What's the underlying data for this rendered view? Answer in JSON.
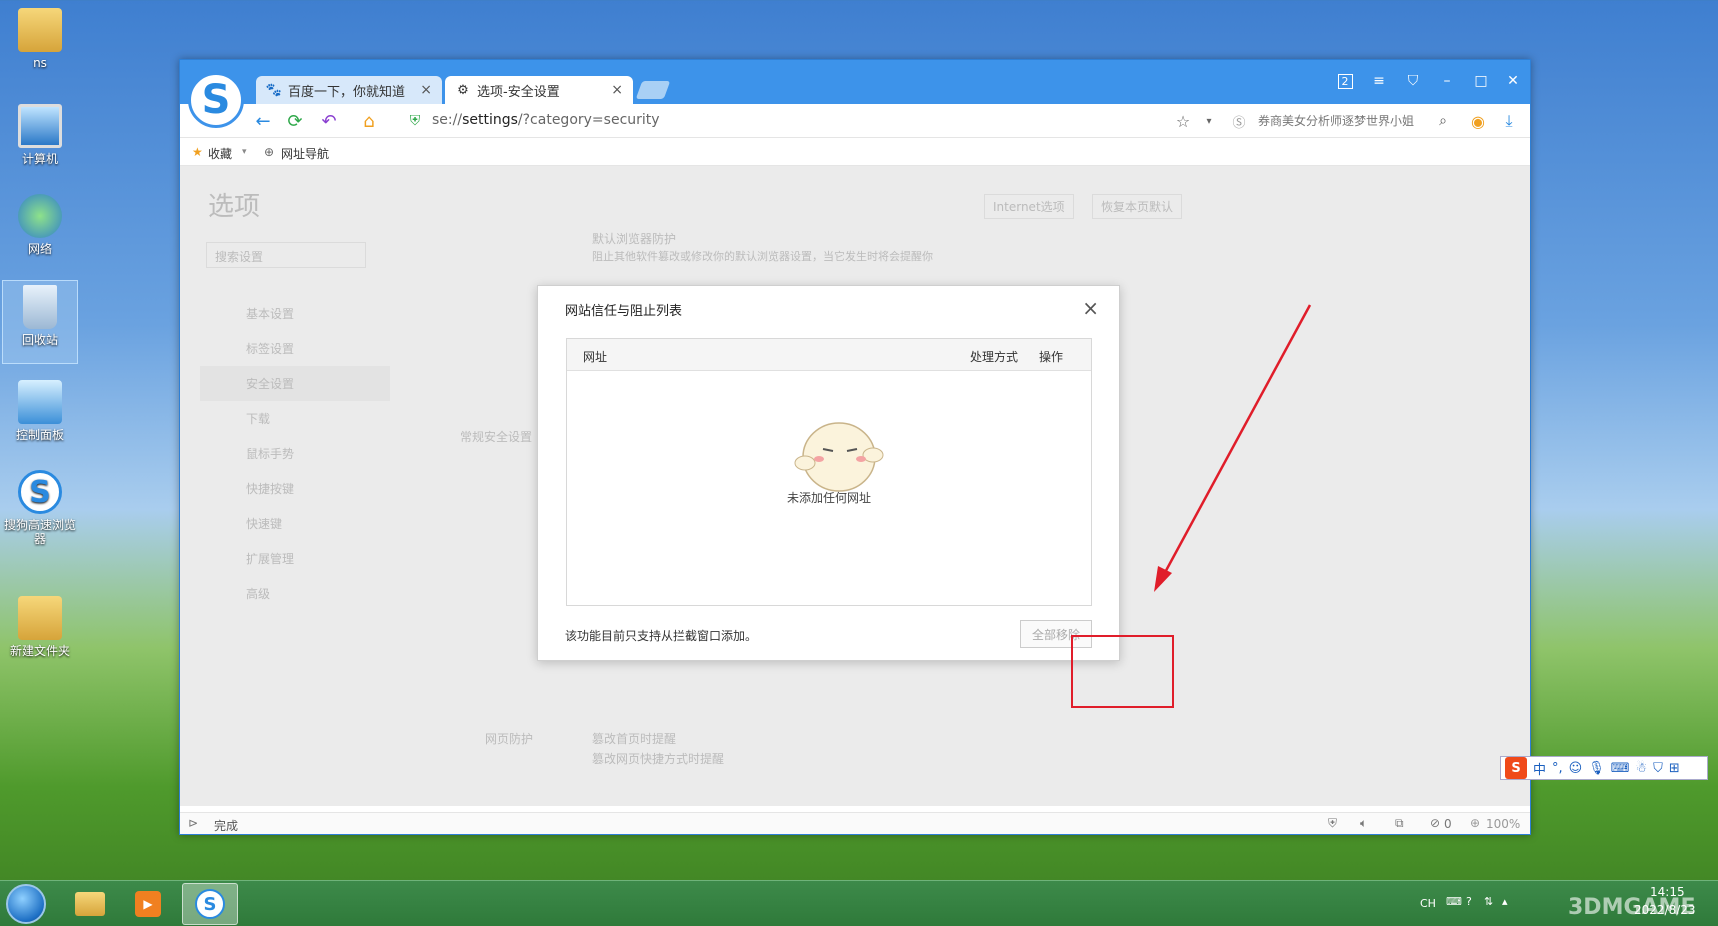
{
  "desktop": {
    "icons": [
      "ns",
      "计算机",
      "网络",
      "回收站",
      "控制面板",
      "搜狗高速浏览器",
      "新建文件夹"
    ]
  },
  "browser": {
    "tabs": [
      {
        "label": "百度一下，你就知道",
        "close": "×"
      },
      {
        "label": "选项-安全设置",
        "close": "×"
      }
    ],
    "window_controls": {
      "badge": "2",
      "menu": "≡",
      "skin": "⛉",
      "min": "–",
      "max": "□",
      "close": "✕"
    },
    "address": {
      "prefix": "se://",
      "path": "settings",
      "suffix": "/?category=security"
    },
    "search_hint": "券商美女分析师逐梦世界小姐",
    "bookmarks": {
      "favorites": "收藏",
      "nav": "网址导航"
    },
    "status": {
      "text": "完成",
      "adblock": "0",
      "zoom": "100%"
    }
  },
  "page": {
    "title": "选项",
    "header_buttons": [
      "Internet选项",
      "恢复本页默认"
    ],
    "search_placeholder": "搜索设置",
    "sidebar": [
      "基本设置",
      "标签设置",
      "安全设置",
      "下载",
      "鼠标手势",
      "快捷按键",
      "快速键",
      "扩展管理",
      "高级"
    ],
    "section_label": "常规安全设置",
    "section_label2": "网页防护",
    "row1_title": "默认浏览器防护",
    "row1_desc": "阻止其他软件篡改或修改你的默认浏览器设置，当它发生时将会提醒你",
    "row2": "篡改首页时提醒",
    "row3": "篡改网页快捷方式时提醒"
  },
  "dialog": {
    "title": "网站信任与阻止列表",
    "col_url": "网址",
    "col_method": "处理方式",
    "col_action": "操作",
    "empty_text": "未添加任何网址",
    "footer_note": "该功能目前只支持从拦截窗口添加。",
    "remove_all": "全部移除"
  },
  "ime": {
    "lang": "中",
    "punct": "°,"
  },
  "taskbar": {
    "lang": "CH",
    "time": "14:15",
    "date": "2022/8/23"
  },
  "watermark": "3DMGAME",
  "colors": {
    "titlebar": "#3d93ea",
    "highlight": "#e01d2a"
  }
}
